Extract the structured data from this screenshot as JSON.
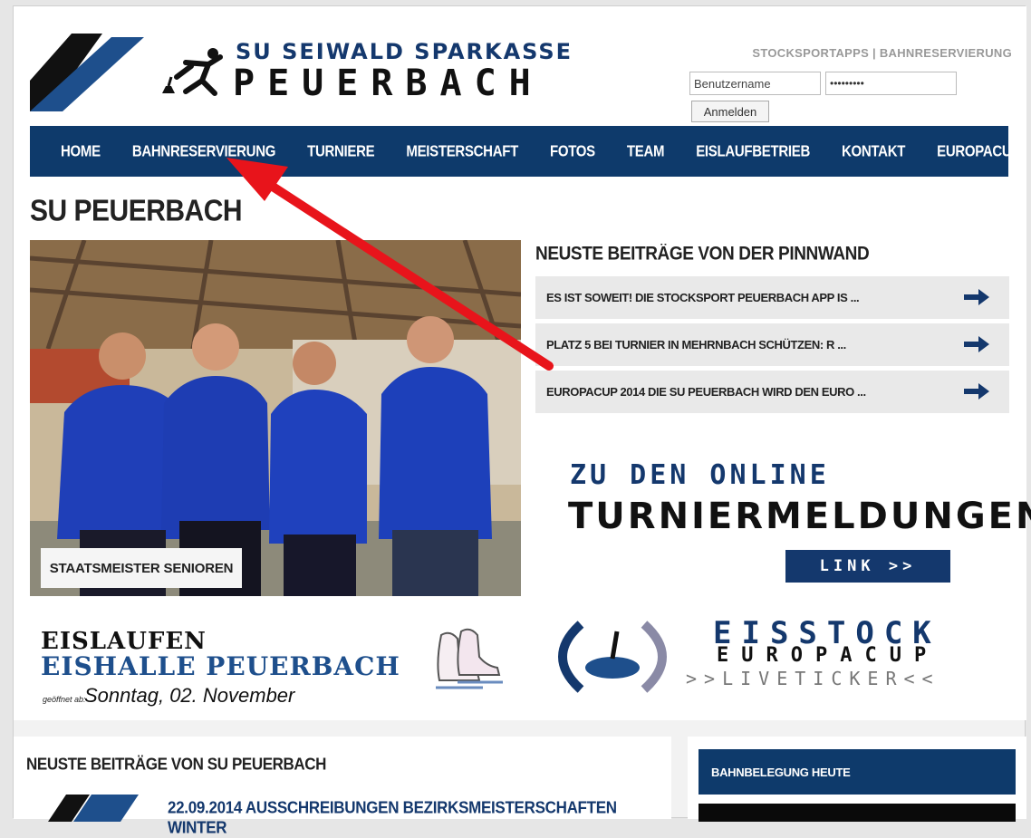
{
  "header": {
    "logo_line1": "SU SEIWALD SPARKASSE",
    "logo_line2": "PEUERBACH",
    "toplink_1": "STOCKSPORTAPPS",
    "toplink_sep": " | ",
    "toplink_2": "BAHNRESERVIERUNG",
    "login": {
      "username_value": "Benutzername",
      "password_value": "•••••••••",
      "button_label": "Anmelden"
    }
  },
  "nav": {
    "items": [
      "HOME",
      "BAHNRESERVIERUNG",
      "TURNIERE",
      "MEISTERSCHAFT",
      "FOTOS",
      "TEAM",
      "EISLAUFBETRIEB",
      "KONTAKT",
      "EUROPACUP"
    ]
  },
  "main": {
    "page_title": "SU PEUERBACH",
    "photo_caption": "STAATSMEISTER SENIOREN",
    "pinnwand": {
      "title": "NEUSTE BEITRÄGE VON DER PINNWAND",
      "items": [
        "ES IST SOWEIT! DIE STOCKSPORT PEUERBACH APP IS ...",
        "PLATZ 5 BEI TURNIER IN MEHRNBACH SCHÜTZEN: R ...",
        "EUROPACUP 2014 DIE SU PEUERBACH WIRD DEN EURO ..."
      ],
      "arrow_icon": "arrow-right-icon"
    },
    "online_banner": {
      "line1": "ZU DEN ONLINE",
      "line2": "TURNIERMELDUNGEN",
      "link_label": "LINK >>"
    },
    "eislaufen_banner": {
      "line1": "EISLAUFEN",
      "line2": "EISHALLE PEUERBACH",
      "small_label": "geöffnet ab:",
      "date": "Sonntag, 02. November"
    },
    "europacup_banner": {
      "line1": "EISSTOCK",
      "line2": "EUROPACUP",
      "line3": ">>LIVETICKER<<"
    }
  },
  "bottom": {
    "news_title": "NEUSTE BEITRÄGE VON SU PEUERBACH",
    "first_post_title": "22.09.2014 AUSSCHREIBUNGEN BEZIRKSMEISTERSCHAFTEN WINTER",
    "sidebar_title": "BAHNBELEGUNG HEUTE"
  },
  "colors": {
    "brand_blue": "#0e3a6b",
    "accent_red": "#e8141b",
    "panel_gray": "#e9e9e9"
  }
}
